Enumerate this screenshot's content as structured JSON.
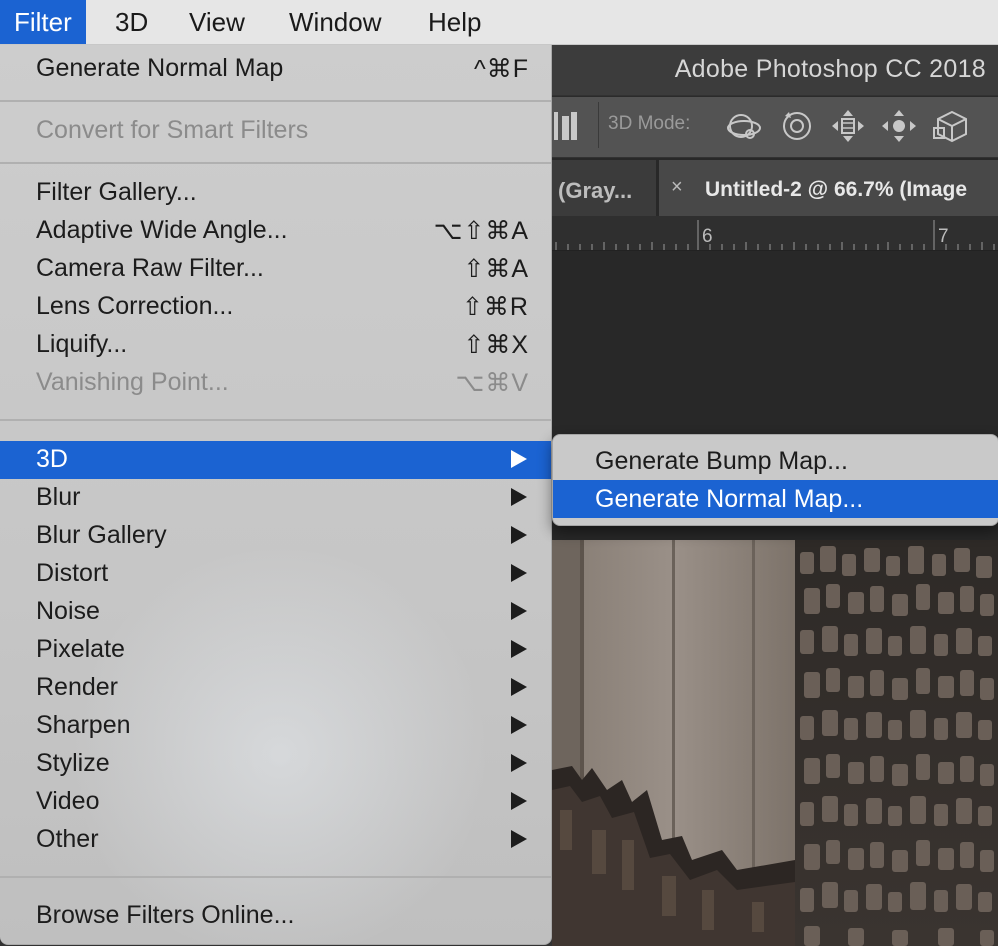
{
  "menubar": {
    "items": [
      "Filter",
      "3D",
      "View",
      "Window",
      "Help"
    ]
  },
  "app": {
    "title": "Adobe Photoshop CC 2018",
    "options_label": "3D Mode:",
    "tab_inactive": "(Gray...",
    "tab_close": "×",
    "tab_active": "Untitled-2 @ 66.7% (Image",
    "ruler_marks": [
      "6",
      "7"
    ]
  },
  "filter_menu": {
    "last_filter": {
      "label": "Generate Normal Map",
      "shortcut": "^⌘F"
    },
    "convert": {
      "label": "Convert for Smart Filters"
    },
    "group_a": [
      {
        "label": "Filter Gallery...",
        "shortcut": ""
      },
      {
        "label": "Adaptive Wide Angle...",
        "shortcut": "⌥⇧⌘A"
      },
      {
        "label": "Camera Raw Filter...",
        "shortcut": "⇧⌘A"
      },
      {
        "label": "Lens Correction...",
        "shortcut": "⇧⌘R"
      },
      {
        "label": "Liquify...",
        "shortcut": "⇧⌘X"
      },
      {
        "label": "Vanishing Point...",
        "shortcut": "⌥⌘V"
      }
    ],
    "submenus": [
      "3D",
      "Blur",
      "Blur Gallery",
      "Distort",
      "Noise",
      "Pixelate",
      "Render",
      "Sharpen",
      "Stylize",
      "Video",
      "Other"
    ],
    "browse": {
      "label": "Browse Filters Online..."
    }
  },
  "submenu_3d": {
    "items": [
      "Generate Bump Map...",
      "Generate Normal Map..."
    ]
  },
  "colors": {
    "highlight": "#1b63d2",
    "menu_bg": "#cdcdcd",
    "app_bg": "#323232"
  }
}
